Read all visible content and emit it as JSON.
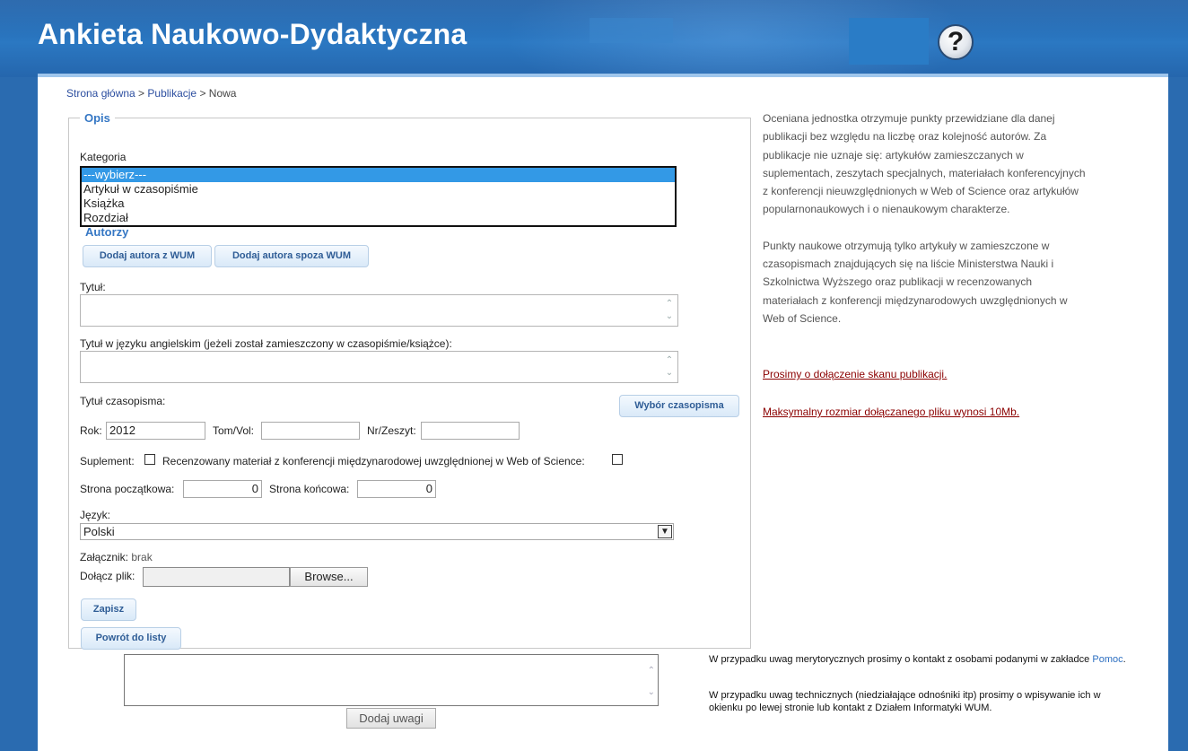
{
  "header": {
    "title": "Ankieta Naukowo-Dydaktyczna",
    "help_icon": "question-mark-icon",
    "help_symbol": "?"
  },
  "breadcrumb": {
    "home": "Strona główna",
    "sep1": " > ",
    "publications": "Publikacje",
    "sep2": " > ",
    "current": "Nowa"
  },
  "form": {
    "legend": "Opis",
    "category_label": "Kategoria",
    "category_options": [
      "---wybierz---",
      "Artykuł w czasopiśmie",
      "Książka",
      "Rozdział"
    ],
    "authors_title": "Autorzy",
    "add_author_wum": "Dodaj autora z WUM",
    "add_author_external": "Dodaj autora spoza WUM",
    "title_label": "Tytuł:",
    "title_en_label": "Tytuł w języku angielskim (jeżeli został zamieszczony w czasopiśmie/książce):",
    "journal_label": "Tytuł czasopisma:",
    "journal_button": "Wybór czasopisma",
    "year_label": "Rok:",
    "year_value": "2012",
    "volume_label": "Tom/Vol:",
    "volume_value": "",
    "issue_label": "Nr/Zeszyt:",
    "issue_value": "",
    "supplement_label": "Suplement:",
    "reviewed_label": "Recenzowany materiał z konferencji międzynarodowej uwzględnionej w Web of Science:",
    "start_page_label": "Strona początkowa:",
    "start_page_value": "0",
    "end_page_label": "Strona końcowa:",
    "end_page_value": "0",
    "language_label": "Język:",
    "language_value": "Polski",
    "attachment_label": "Załącznik:",
    "attachment_value": "brak",
    "attach_file_label": "Dołącz plik:",
    "browse_label": "Browse...",
    "save_button": "Zapisz",
    "back_button": "Powrót do listy"
  },
  "right_panel": {
    "paragraph1": "Oceniana jednostka otrzymuje punkty przewidziane dla danej publikacji bez względu na liczbę oraz kolejność autorów. Za publikacje nie uznaje się: artykułów zamieszczanych w suplementach, zeszytach specjalnych, materiałach konferencyjnych z konferencji nieuwzględnionych w Web of Science oraz artykułów popularnonaukowych i o nienaukowym charakterze.",
    "paragraph2": "Punkty naukowe otrzymują tylko artykuły w zamieszczone w czasopismach znajdujących się na liście Ministerstwa Nauki i Szkolnictwa Wyższego oraz publikacji w recenzowanych materiałach z konferencji międzynarodowych uwzględnionych w Web of Science.",
    "link1": "Prosimy o dołączenie skanu publikacji.",
    "link2": "Maksymalny rozmiar dołączanego pliku wynosi 10Mb."
  },
  "comments": {
    "add_button": "Dodaj uwagi",
    "info1_text": "W przypadku uwag merytorycznych prosimy o kontakt z osobami podanymi w zakładce",
    "info1_link": "Pomoc",
    "info1_end": ".",
    "info2_text": "W przypadku uwag technicznych (niedziałające odnośniki itp) prosimy o wpisywanie ich w okienku po lewej stronie lub kontakt z Działem Informatyki WUM."
  },
  "colors": {
    "header_blue": "#2b78c2",
    "accent_blue": "#3577c4",
    "link_red": "#8b0000",
    "selection_blue": "#3399e6"
  }
}
